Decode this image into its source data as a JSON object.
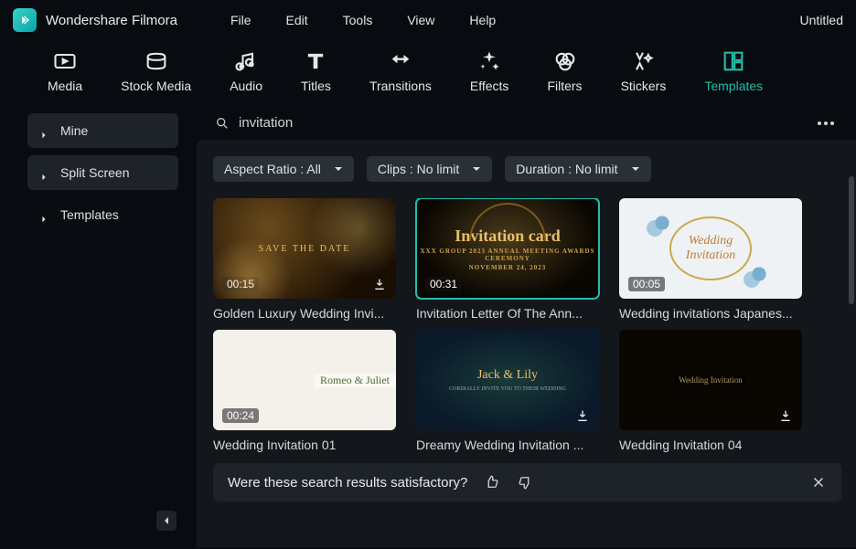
{
  "app": {
    "name": "Wondershare Filmora",
    "document": "Untitled"
  },
  "menu": [
    "File",
    "Edit",
    "Tools",
    "View",
    "Help"
  ],
  "tools": [
    {
      "label": "Media"
    },
    {
      "label": "Stock Media"
    },
    {
      "label": "Audio"
    },
    {
      "label": "Titles"
    },
    {
      "label": "Transitions"
    },
    {
      "label": "Effects"
    },
    {
      "label": "Filters"
    },
    {
      "label": "Stickers"
    },
    {
      "label": "Templates"
    }
  ],
  "sidebar": [
    {
      "label": "Mine"
    },
    {
      "label": "Split Screen"
    },
    {
      "label": "Templates"
    }
  ],
  "search": {
    "value": "invitation"
  },
  "filters": {
    "aspect": "Aspect Ratio : All",
    "clips": "Clips : No limit",
    "duration": "Duration : No limit"
  },
  "templates": [
    {
      "label": "Golden Luxury Wedding Invi...",
      "duration": "00:15"
    },
    {
      "label": "Invitation Letter Of The Ann...",
      "duration": "00:31"
    },
    {
      "label": "Wedding invitations Japanes...",
      "duration": "00:05"
    },
    {
      "label": "Wedding Invitation 01",
      "duration": "00:24"
    },
    {
      "label": "Dreamy Wedding Invitation ...",
      "duration": ""
    },
    {
      "label": "Wedding Invitation 04",
      "duration": ""
    }
  ],
  "feedback": {
    "question": "Were these search results satisfactory?"
  },
  "thumbtext": {
    "save": "SAVE THE DATE",
    "inv": "Invitation card",
    "invsub": "XXX GROUP 2023 ANNUAL MEETING AWARDS CEREMONY",
    "date": "NOVEMBER 24, 2023",
    "wed": "Wedding",
    "winv": "Invitation",
    "names": "Romeo & Juliet",
    "jack": "Jack & Lily",
    "wi": "Wedding Invitation"
  }
}
